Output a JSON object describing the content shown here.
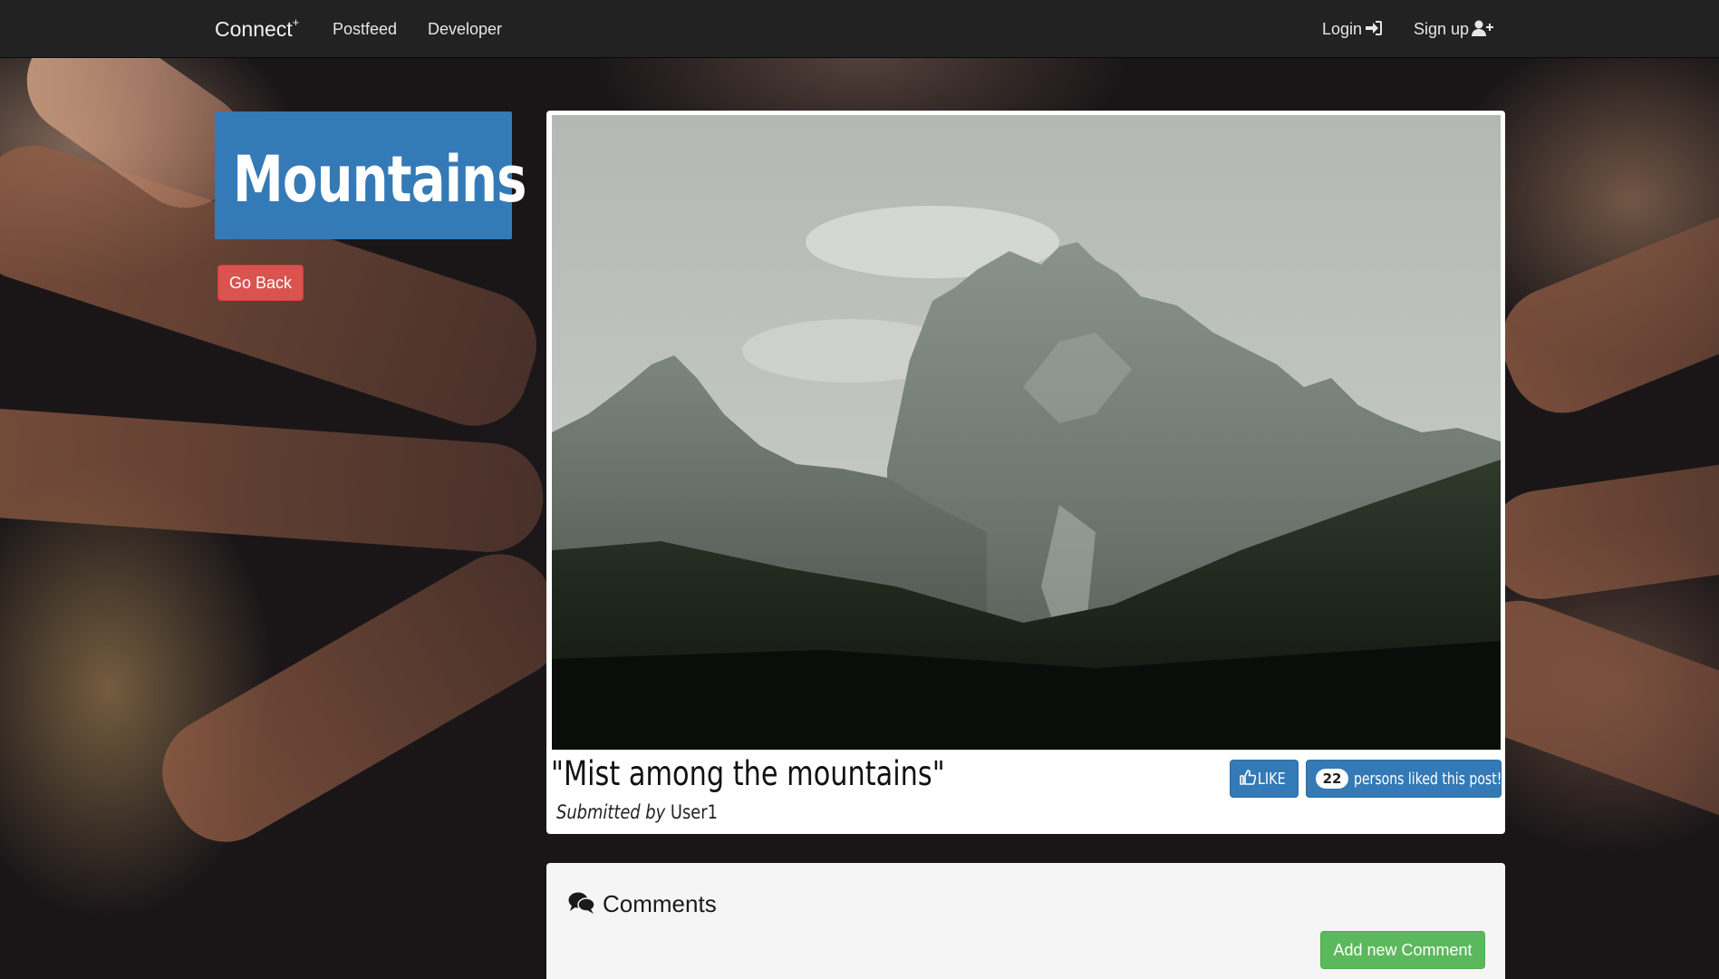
{
  "navbar": {
    "brand": "Connect",
    "brand_sup": "+",
    "links": [
      "Postfeed",
      "Developer"
    ],
    "login": "Login",
    "signup": "Sign up"
  },
  "page": {
    "title": "Mountains",
    "go_back": "Go Back"
  },
  "post": {
    "title": "\"Mist among the mountains\"",
    "submitted_by_label": "Submitted by",
    "author": "User1",
    "like_label": "LIKE",
    "like_count": "22",
    "likes_text": "persons liked this post!"
  },
  "comments": {
    "title": "Comments",
    "add_button": "Add new Comment"
  },
  "colors": {
    "primary": "#337ab7",
    "danger": "#d9534f",
    "success": "#5cb85c",
    "navbar": "#222222"
  },
  "icons": {
    "login": "sign-in-icon",
    "signup": "user-plus-icon",
    "like": "thumbs-up-icon",
    "comments": "comments-icon"
  }
}
